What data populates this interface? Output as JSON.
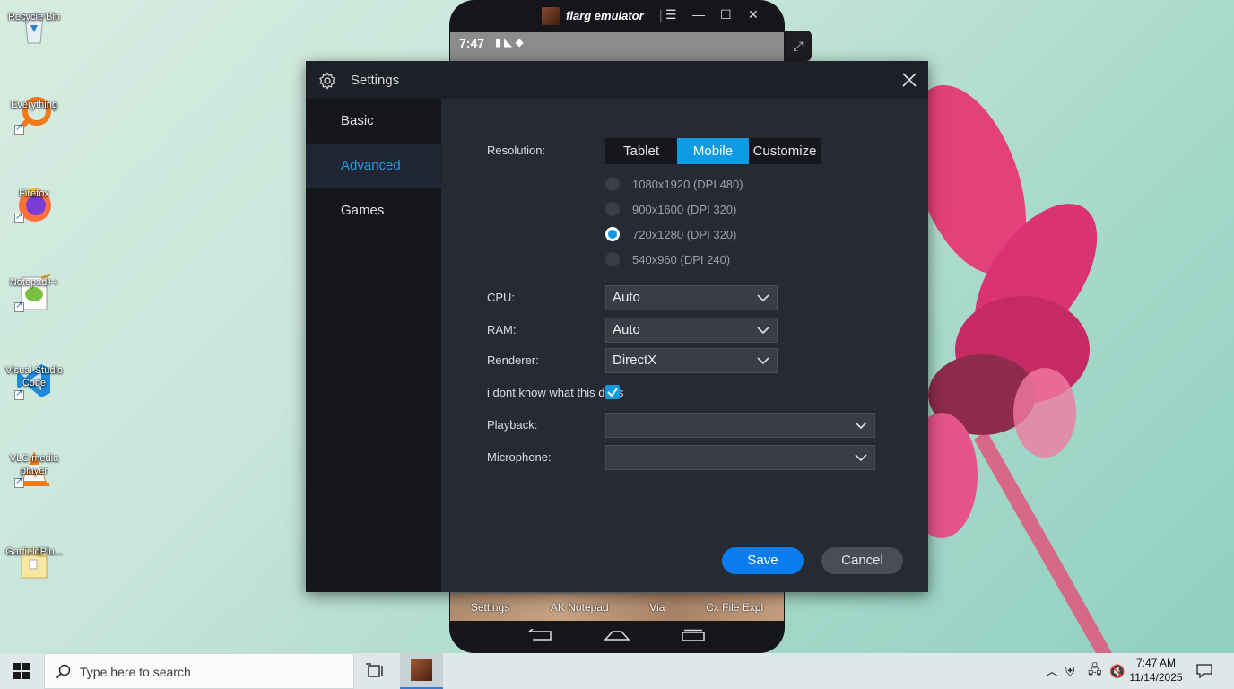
{
  "desktop": {
    "icons": [
      {
        "label": "Recycle Bin"
      },
      {
        "label": "Everything"
      },
      {
        "label": "Firefox"
      },
      {
        "label": "Notepad++"
      },
      {
        "label": "Visual Studio Code"
      },
      {
        "label": "VLC media player"
      },
      {
        "label": "GarfieldPlu..."
      }
    ]
  },
  "emulator": {
    "title": "flarg emulator",
    "status_time": "7:47",
    "dock_items": [
      "Settings",
      "AK Notepad",
      "Via",
      "Cx File Expl"
    ]
  },
  "settings": {
    "title": "Settings",
    "sidebar": [
      {
        "label": "Basic"
      },
      {
        "label": "Advanced"
      },
      {
        "label": "Games"
      }
    ],
    "active_tab": "Advanced",
    "resolution_label": "Resolution:",
    "resolution_modes": [
      "Tablet",
      "Mobile",
      "Customize"
    ],
    "selected_mode": "Mobile",
    "resolutions": [
      {
        "label": "1080x1920 (DPI 480)",
        "selected": false
      },
      {
        "label": "900x1600 (DPI 320)",
        "selected": false
      },
      {
        "label": "720x1280 (DPI 320)",
        "selected": true
      },
      {
        "label": "540x960 (DPI 240)",
        "selected": false
      }
    ],
    "cpu_label": "CPU:",
    "cpu_value": "Auto",
    "ram_label": "RAM:",
    "ram_value": "Auto",
    "renderer_label": "Renderer:",
    "renderer_value": "DirectX",
    "checkbox_label": "i dont know what this does",
    "checkbox_checked": true,
    "playback_label": "Playback:",
    "playback_value": "",
    "microphone_label": "Microphone:",
    "microphone_value": "",
    "save_label": "Save",
    "cancel_label": "Cancel"
  },
  "taskbar": {
    "search_placeholder": "Type here to search",
    "time": "7:47 AM",
    "date": "11/14/2025"
  },
  "colors": {
    "accent": "#0f9ae6",
    "save_button": "#0a7cf0",
    "dialog_bg": "#272a33",
    "sidebar_bg": "#15161b"
  }
}
